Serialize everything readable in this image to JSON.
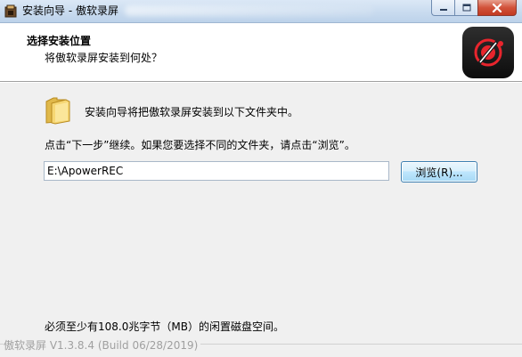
{
  "window": {
    "title": "安装向导 - 傲软录屏"
  },
  "header": {
    "title": "选择安装位置",
    "subtitle": "将傲软录屏安装到何处？",
    "logo_icon": "record-logo-icon"
  },
  "body": {
    "info_line": "安装向导将把傲软录屏安装到以下文件夹中。",
    "instruction": "点击“下一步”继续。如果您要选择不同的文件夹，请点击“浏览”。",
    "install_path": "E:\\ApowerREC",
    "browse_label": "浏览(R)...",
    "space_required": "必须至少有108.0兆字节（MB）的闲置磁盘空间。"
  },
  "footer": {
    "version": "傲软录屏 V1.3.8.4 (Build 06/28/2019)"
  },
  "colors": {
    "logo_bg": "#1a1a1a",
    "logo_accent": "#e8252d",
    "close_button": "#c8432a",
    "browse_border": "#3c7fb1"
  }
}
